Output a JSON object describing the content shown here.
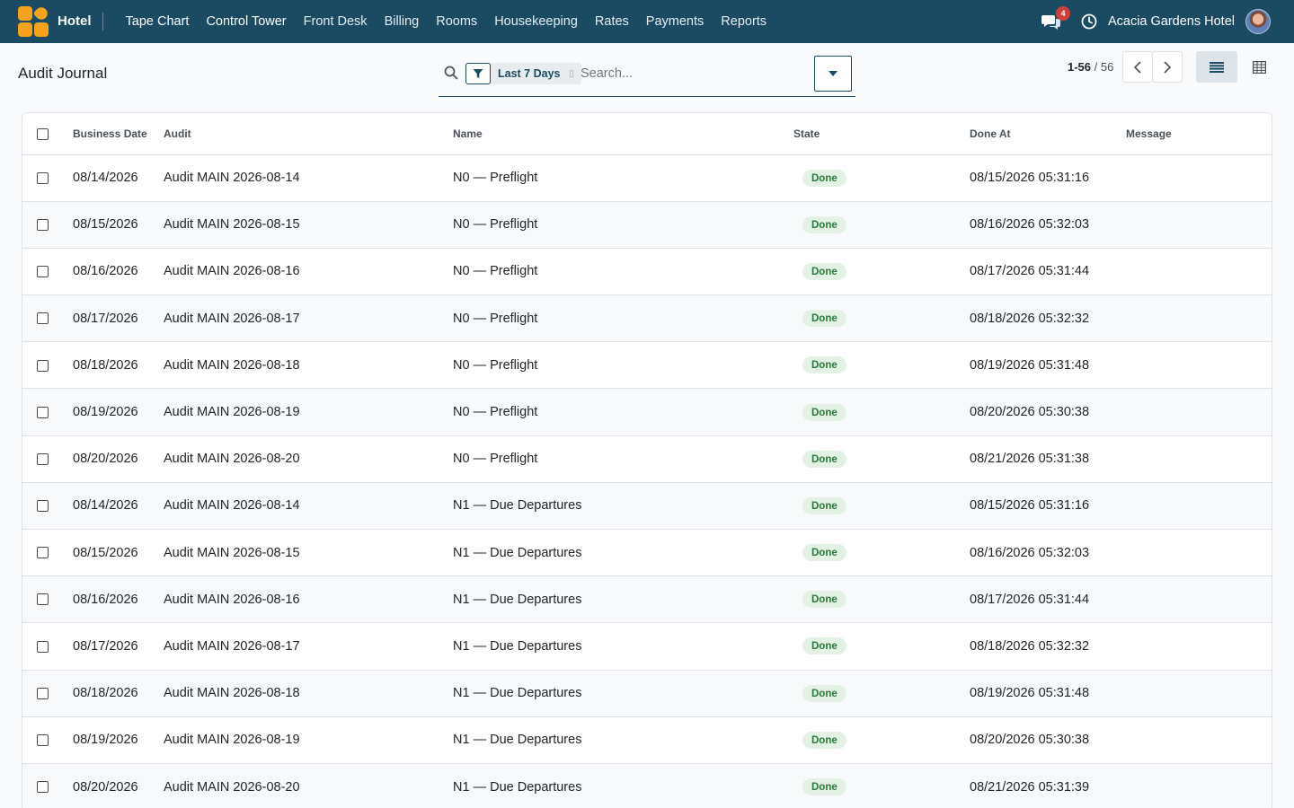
{
  "navbar": {
    "app_name": "Hotel",
    "menu": [
      {
        "label": "Tape Chart",
        "strong": true
      },
      {
        "label": "Control Tower",
        "strong": true
      },
      {
        "label": "Front Desk",
        "strong": false
      },
      {
        "label": "Billing",
        "strong": false
      },
      {
        "label": "Rooms",
        "strong": false
      },
      {
        "label": "Housekeeping",
        "strong": false
      },
      {
        "label": "Rates",
        "strong": false
      },
      {
        "label": "Payments",
        "strong": false
      },
      {
        "label": "Reports",
        "strong": false
      }
    ],
    "chat_count": "4",
    "company": "Acacia Gardens Hotel",
    "colors": {
      "bg": "#1a4b63",
      "logo": "#f7a21b",
      "badge": "#d23f3a"
    }
  },
  "control_panel": {
    "title": "Audit Journal",
    "facet_label": "Last 7 Days",
    "search_placeholder": "Search...",
    "pager_range": "1-56",
    "pager_separator": " / ",
    "pager_total": "56"
  },
  "table": {
    "columns": [
      "Business Date",
      "Audit",
      "Name",
      "State",
      "Done At",
      "Message"
    ],
    "rows": [
      [
        "08/14/2026",
        "Audit MAIN 2026-08-14",
        "N0 — Preflight",
        "Done",
        "08/15/2026 05:31:16",
        ""
      ],
      [
        "08/15/2026",
        "Audit MAIN 2026-08-15",
        "N0 — Preflight",
        "Done",
        "08/16/2026 05:32:03",
        ""
      ],
      [
        "08/16/2026",
        "Audit MAIN 2026-08-16",
        "N0 — Preflight",
        "Done",
        "08/17/2026 05:31:44",
        ""
      ],
      [
        "08/17/2026",
        "Audit MAIN 2026-08-17",
        "N0 — Preflight",
        "Done",
        "08/18/2026 05:32:32",
        ""
      ],
      [
        "08/18/2026",
        "Audit MAIN 2026-08-18",
        "N0 — Preflight",
        "Done",
        "08/19/2026 05:31:48",
        ""
      ],
      [
        "08/19/2026",
        "Audit MAIN 2026-08-19",
        "N0 — Preflight",
        "Done",
        "08/20/2026 05:30:38",
        ""
      ],
      [
        "08/20/2026",
        "Audit MAIN 2026-08-20",
        "N0 — Preflight",
        "Done",
        "08/21/2026 05:31:38",
        ""
      ],
      [
        "08/14/2026",
        "Audit MAIN 2026-08-14",
        "N1 — Due Departures",
        "Done",
        "08/15/2026 05:31:16",
        ""
      ],
      [
        "08/15/2026",
        "Audit MAIN 2026-08-15",
        "N1 — Due Departures",
        "Done",
        "08/16/2026 05:32:03",
        ""
      ],
      [
        "08/16/2026",
        "Audit MAIN 2026-08-16",
        "N1 — Due Departures",
        "Done",
        "08/17/2026 05:31:44",
        ""
      ],
      [
        "08/17/2026",
        "Audit MAIN 2026-08-17",
        "N1 — Due Departures",
        "Done",
        "08/18/2026 05:32:32",
        ""
      ],
      [
        "08/18/2026",
        "Audit MAIN 2026-08-18",
        "N1 — Due Departures",
        "Done",
        "08/19/2026 05:31:48",
        ""
      ],
      [
        "08/19/2026",
        "Audit MAIN 2026-08-19",
        "N1 — Due Departures",
        "Done",
        "08/20/2026 05:30:38",
        ""
      ],
      [
        "08/20/2026",
        "Audit MAIN 2026-08-20",
        "N1 — Due Departures",
        "Done",
        "08/21/2026 05:31:39",
        ""
      ]
    ],
    "state_colors": {
      "done_text": "#2b7a3c",
      "done_bg": "#e3f2e5"
    }
  }
}
